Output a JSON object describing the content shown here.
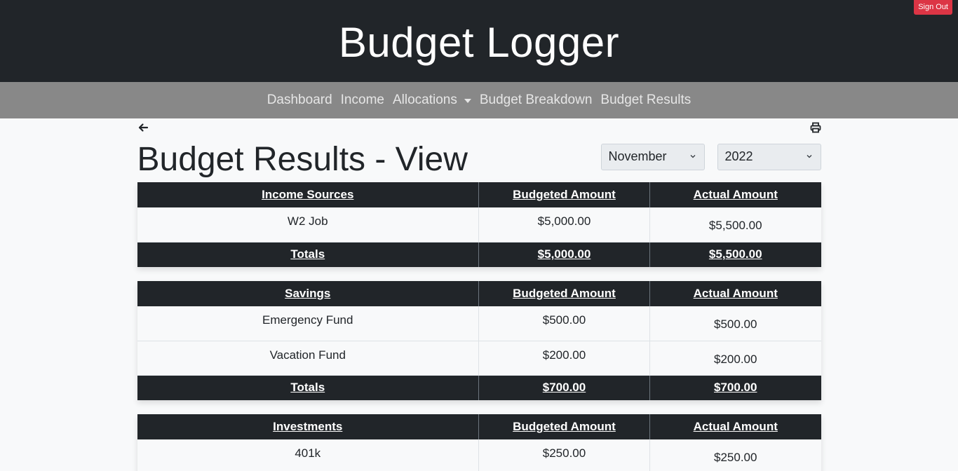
{
  "header": {
    "app_title": "Budget Logger",
    "sign_out_label": "Sign Out",
    "sign_out_color": "#dc3545"
  },
  "nav": {
    "items": [
      {
        "label": "Dashboard"
      },
      {
        "label": "Income"
      },
      {
        "label": "Allocations",
        "has_dropdown": true
      },
      {
        "label": "Budget Breakdown"
      },
      {
        "label": "Budget Results"
      }
    ]
  },
  "toolbar": {
    "back_icon": "arrow-left-icon",
    "print_icon": "printer-icon"
  },
  "page": {
    "title": "Budget Results - View",
    "month_select": {
      "value": "November"
    },
    "year_select": {
      "value": "2022"
    }
  },
  "tables": [
    {
      "headers": [
        "Income Sources",
        "Budgeted Amount",
        "Actual Amount"
      ],
      "rows": [
        [
          "W2 Job",
          "$5,000.00",
          "$5,500.00"
        ]
      ],
      "totals": [
        "Totals",
        "$5,000.00",
        "$5,500.00"
      ]
    },
    {
      "headers": [
        "Savings",
        "Budgeted Amount",
        "Actual Amount"
      ],
      "rows": [
        [
          "Emergency Fund",
          "$500.00",
          "$500.00"
        ],
        [
          "Vacation Fund",
          "$200.00",
          "$200.00"
        ]
      ],
      "totals": [
        "Totals",
        "$700.00",
        "$700.00"
      ]
    },
    {
      "headers": [
        "Investments",
        "Budgeted Amount",
        "Actual Amount"
      ],
      "rows": [
        [
          "401k",
          "$250.00",
          "$250.00"
        ]
      ],
      "totals": null
    }
  ]
}
